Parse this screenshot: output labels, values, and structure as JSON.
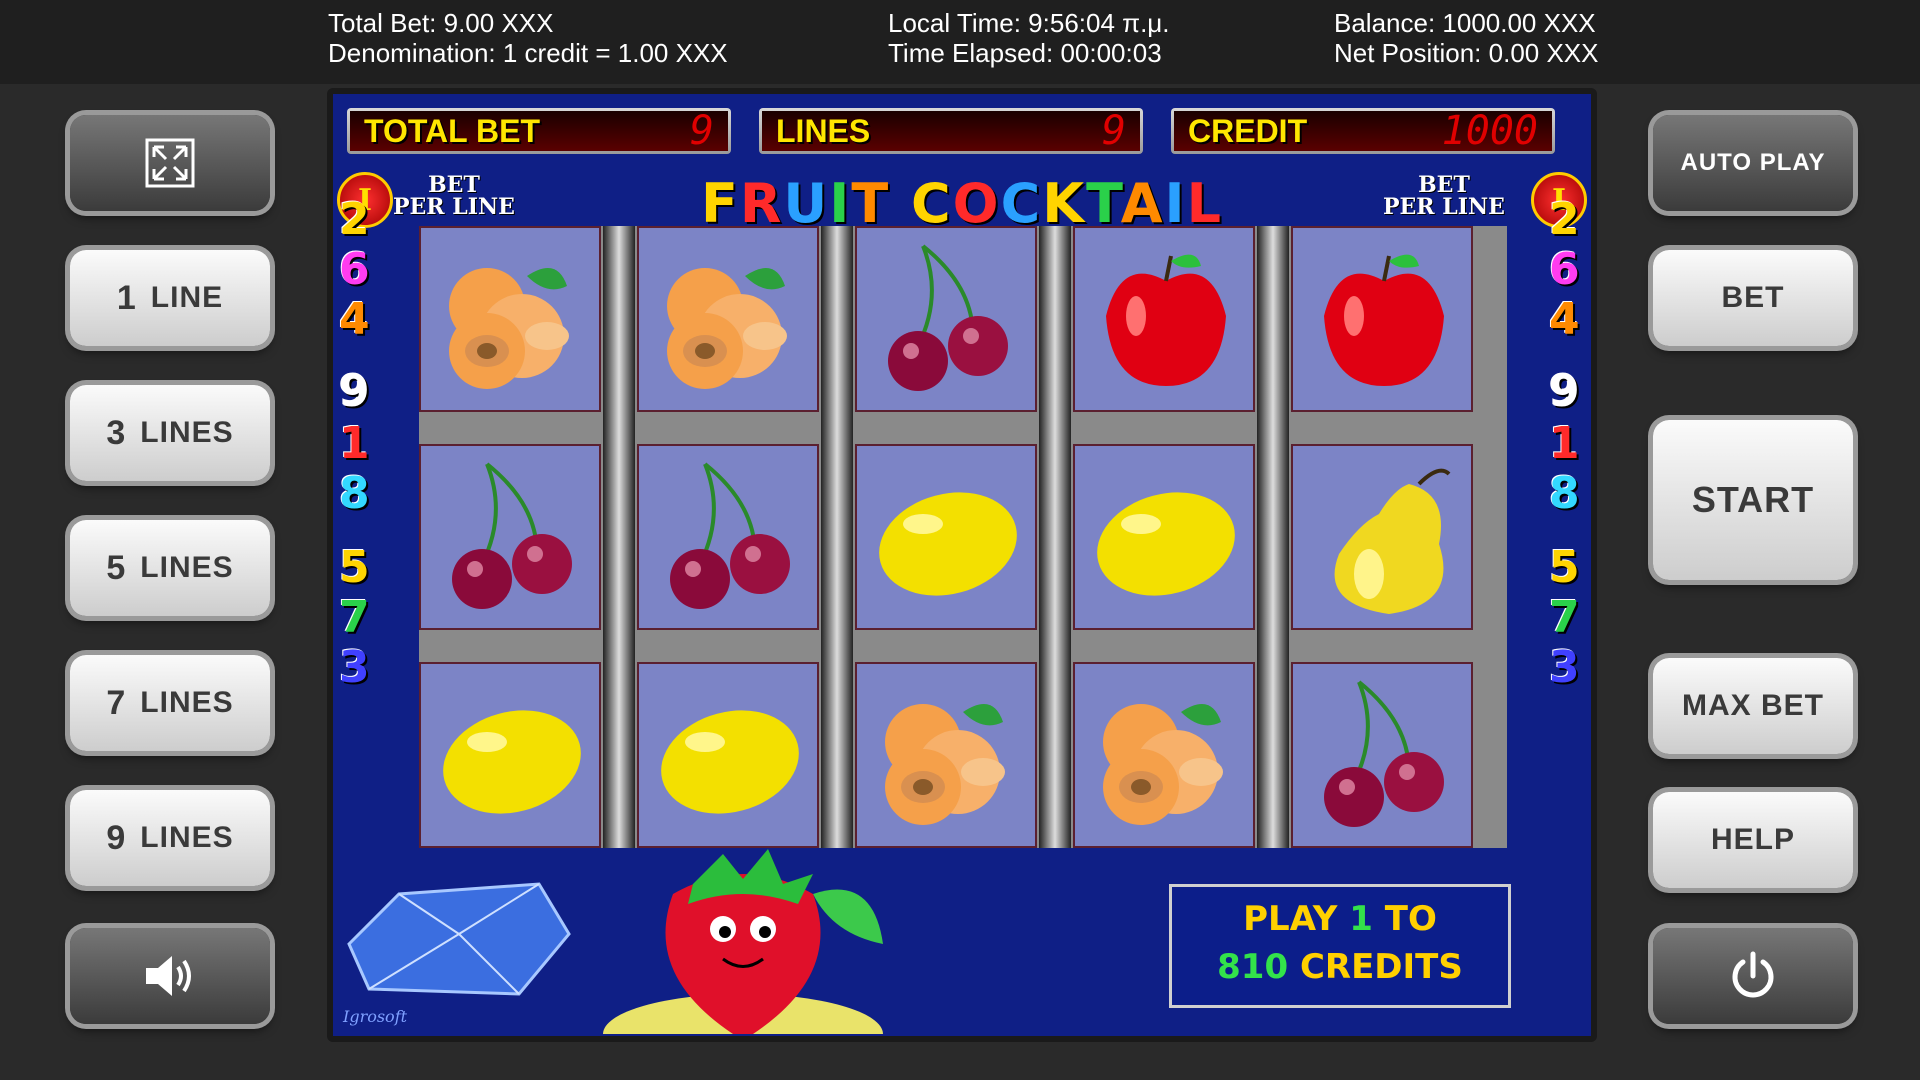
{
  "topbar": {
    "total_bet": "Total Bet: 9.00 XXX",
    "denomination": "Denomination: 1 credit = 1.00 XXX",
    "local_time": "Local Time: 9:56:04 π.μ.",
    "time_elapsed": "Time Elapsed: 00:00:03",
    "balance": "Balance: 1000.00 XXX",
    "net_position": "Net Position: 0.00 XXX"
  },
  "left_buttons": {
    "fullscreen_icon": "fullscreen-icon",
    "line1": {
      "num": "1",
      "label": "LINE"
    },
    "line3": {
      "num": "3",
      "label": "LINES"
    },
    "line5": {
      "num": "5",
      "label": "LINES"
    },
    "line7": {
      "num": "7",
      "label": "LINES"
    },
    "line9": {
      "num": "9",
      "label": "LINES"
    },
    "sound_icon": "speaker-icon"
  },
  "right_buttons": {
    "auto_play": "AUTO PLAY",
    "bet": "BET",
    "start": "START",
    "max_bet": "MAX BET",
    "help": "HELP",
    "power_icon": "power-icon"
  },
  "game": {
    "total_bet_label": "TOTAL BET",
    "total_bet_value": "9",
    "lines_label": "LINES",
    "lines_value": "9",
    "credit_label": "CREDIT",
    "credit_value": "1000",
    "title_letters": [
      "F",
      "R",
      "U",
      "I",
      "T",
      " ",
      "C",
      "O",
      "C",
      "K",
      "T",
      "A",
      "I",
      "L"
    ],
    "bet_per_line_top": "BET",
    "bet_per_line_bottom": "PER LINE",
    "bet_per_line_value": "I",
    "line_numbers": [
      "2",
      "6",
      "4",
      "9",
      "1",
      "8",
      "5",
      "7",
      "3"
    ],
    "reels": [
      [
        "apricot",
        "cherry",
        "lemon"
      ],
      [
        "apricot",
        "cherry",
        "lemon"
      ],
      [
        "cherry",
        "lemon",
        "apricot"
      ],
      [
        "apple",
        "lemon",
        "apricot"
      ],
      [
        "apple",
        "pear",
        "cherry"
      ]
    ],
    "play_line1_a": "PLAY ",
    "play_line1_num": "1",
    "play_line1_b": " TO",
    "play_line2_num": "810",
    "play_line2_b": " CREDITS",
    "logo": "Igrosoft",
    "colors": {
      "meter_label": "#ffe600",
      "meter_value": "#e00000",
      "board": "#0f1f86",
      "cell": "#7c84c6"
    }
  }
}
